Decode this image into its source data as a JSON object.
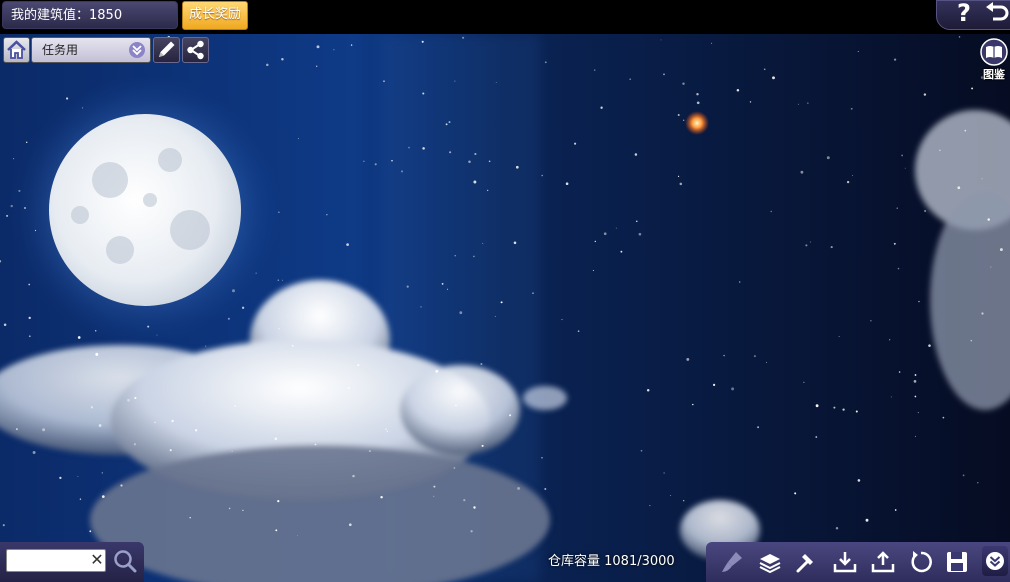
{
  "header": {
    "score_label": "我的建筑值：1850",
    "reward_button": "成长奖励",
    "help_glyph": "?"
  },
  "toolbar_top": {
    "mode_select_value": "任务用"
  },
  "side": {
    "catalog_label": "图鉴"
  },
  "bottom": {
    "search": {
      "value": "",
      "placeholder": "",
      "clear_glyph": "✕"
    },
    "capacity_text": "仓库容量 1081/3000",
    "tools": [
      "brush-icon",
      "layers-icon",
      "hammer-icon",
      "download-icon",
      "upload-icon",
      "rotate-icon",
      "save-icon"
    ]
  },
  "colors": {
    "reward_gold": "#f0a820",
    "panel_purple": "#3a386a",
    "sky_deep": "#050c24",
    "sky_blue": "#143a78"
  },
  "icons": [
    "home-icon",
    "chevron-down-icon",
    "pencil-icon",
    "share-icon",
    "help-icon",
    "back-arrow-icon",
    "book-icon",
    "search-icon"
  ]
}
